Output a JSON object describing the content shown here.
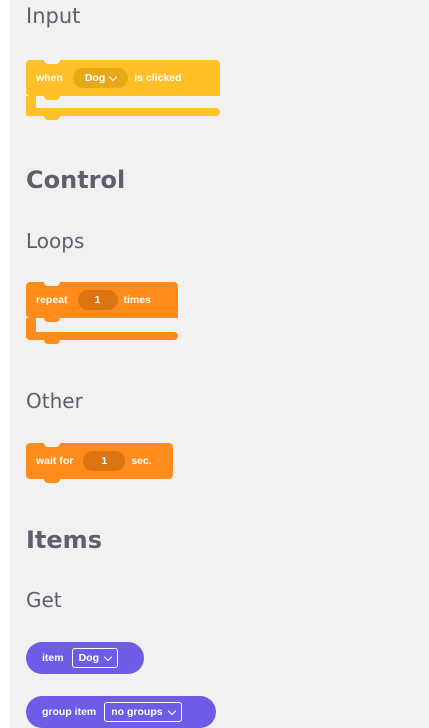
{
  "colors": {
    "events": "#ffbf26",
    "events_dark": "#e6a91a",
    "control": "#ff8c1a",
    "control_dark": "#db7413",
    "items": "#6f5ce6",
    "palette_bg": "#f1f1f2",
    "heading_text": "#5b5f6e"
  },
  "sections": {
    "input": {
      "title": "Input",
      "when_block": {
        "prefix": "when",
        "dropdown_value": "Dog",
        "suffix": "is clicked"
      }
    },
    "control": {
      "title": "Control",
      "loops_title": "Loops",
      "repeat_block": {
        "prefix": "repeat",
        "value": "1",
        "suffix": "times"
      },
      "other_title": "Other",
      "wait_block": {
        "prefix": "wait for",
        "value": "1",
        "suffix": "sec."
      }
    },
    "items": {
      "title": "Items",
      "get_title": "Get",
      "item_block": {
        "label": "item",
        "dropdown_value": "Dog"
      },
      "group_item_block": {
        "label": "group item",
        "dropdown_value": "no groups"
      }
    }
  }
}
